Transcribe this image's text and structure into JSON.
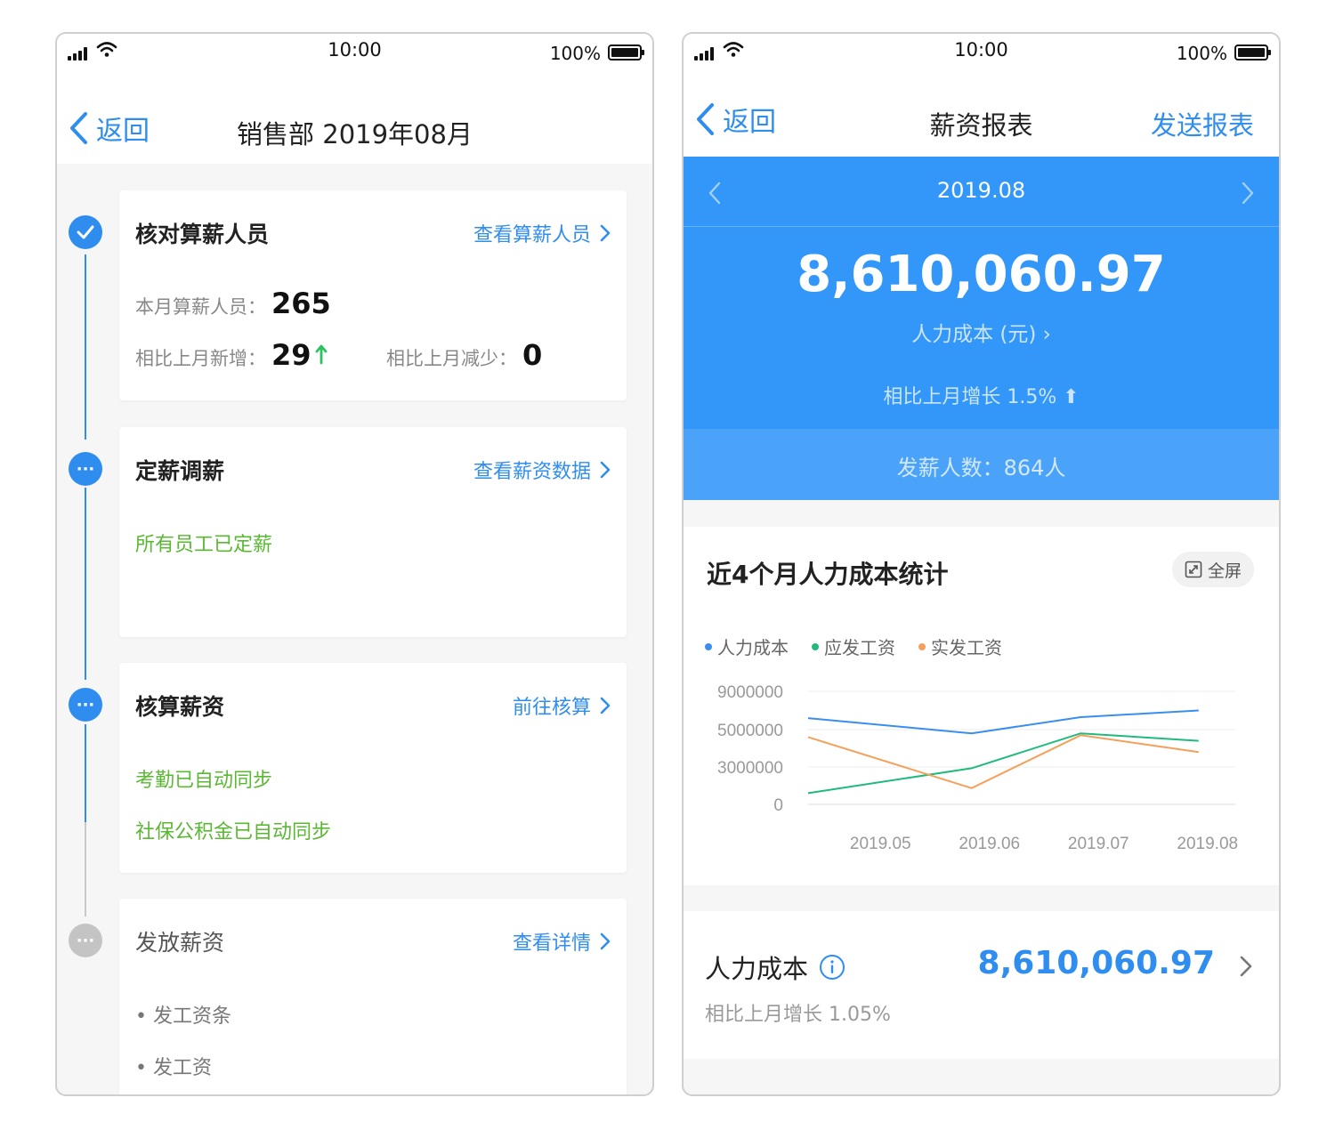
{
  "status_bar": {
    "time": "10:00",
    "battery": "100%"
  },
  "left": {
    "nav": {
      "back": "返回",
      "title": "销售部 2019年08月"
    },
    "steps": [
      {
        "title": "核对算薪人员",
        "link": "查看算薪人员",
        "headcount_label": "本月算薪人员：",
        "headcount": "265",
        "added_label": "相比上月新增：",
        "added": "29",
        "removed_label": "相比上月减少：",
        "removed": "0"
      },
      {
        "title": "定薪调薪",
        "link": "查看薪资数据",
        "notes": [
          "所有员工已定薪"
        ]
      },
      {
        "title": "核算薪资",
        "link": "前往核算",
        "notes": [
          "考勤已自动同步",
          "社保公积金已自动同步"
        ]
      },
      {
        "title": "发放薪资",
        "link": "查看详情",
        "items": [
          "• 发工资条",
          "• 发工资"
        ]
      }
    ]
  },
  "right": {
    "nav": {
      "back": "返回",
      "title": "薪资报表",
      "action": "发送报表"
    },
    "hero": {
      "month": "2019.08",
      "amount": "8,610,060.97",
      "label": "人力成本 (元) ›",
      "growth": "相比上月增长 1.5% ⬆",
      "count": "发薪人数：864人"
    },
    "chart_card": {
      "title": "近4个月人力成本统计",
      "fullscreen": "全屏"
    },
    "cost": {
      "title": "人力成本",
      "sub": "相比上月增长 1.05%",
      "amount": "8,610,060.97"
    }
  },
  "colors": {
    "accent": "#2f8df0",
    "hero_blue": "#3297f8",
    "green": "#5ab833"
  },
  "chart_data": {
    "type": "line",
    "categories": [
      "2019.05",
      "2019.06",
      "2019.07",
      "2019.08"
    ],
    "yticks": [
      "9000000",
      "5000000",
      "3000000",
      "0"
    ],
    "series": [
      {
        "name": "人力成本",
        "color": "#3a8ef0",
        "values": [
          6200000,
          4800000,
          6300000,
          7000000
        ]
      },
      {
        "name": "应发工资",
        "color": "#1fba7c",
        "values": [
          900000,
          2900000,
          4800000,
          4400000
        ]
      },
      {
        "name": "实发工资",
        "color": "#f5a05a",
        "values": [
          4600000,
          1300000,
          4700000,
          3800000
        ]
      }
    ]
  }
}
